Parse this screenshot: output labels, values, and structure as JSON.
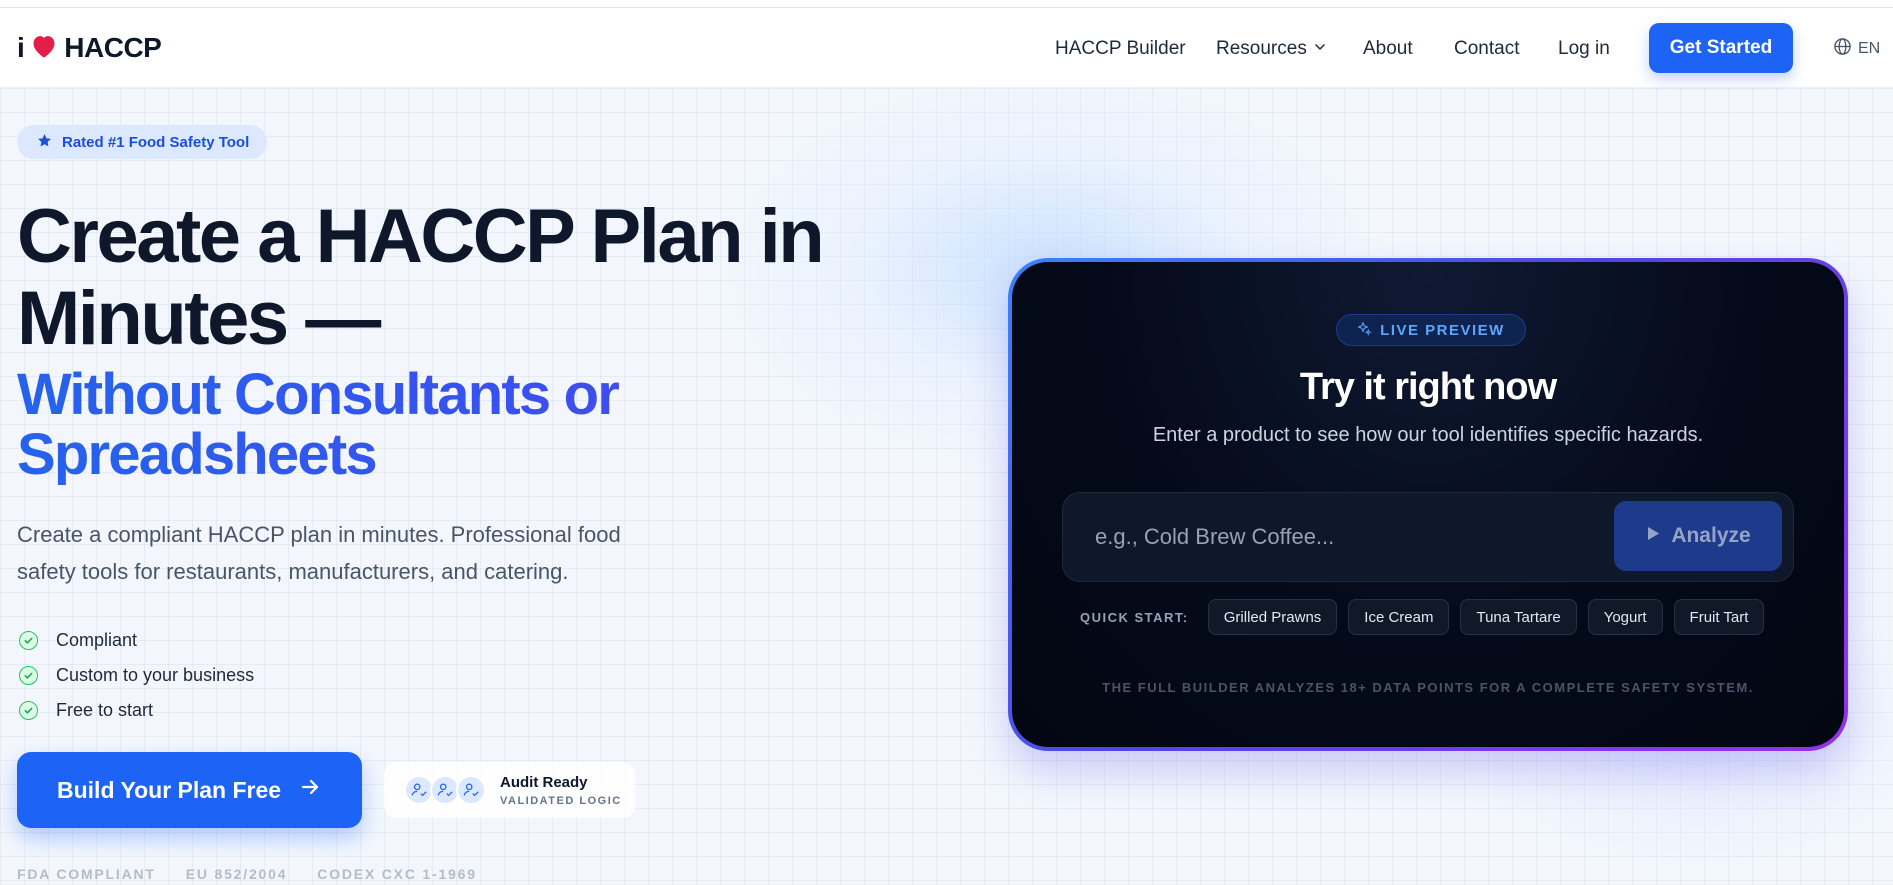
{
  "nav": {
    "logo_i": "i",
    "logo_text": "HACCP",
    "links": {
      "builder": "HACCP Builder",
      "resources": "Resources",
      "about": "About",
      "contact": "Contact",
      "login": "Log in"
    },
    "cta": "Get Started",
    "language": "EN"
  },
  "hero": {
    "badge": "Rated #1 Food Safety Tool",
    "title_line1": "Create a HACCP Plan in",
    "title_line2": "Minutes —",
    "accent_line1": "Without Consultants or",
    "accent_line2": "Spreadsheets",
    "subtitle": "Create a compliant HACCP plan in minutes. Professional food safety tools for restaurants, manufacturers, and catering.",
    "checks": [
      "Compliant",
      "Custom to your business",
      "Free to start"
    ],
    "cta": "Build Your Plan Free",
    "audit_title": "Audit Ready",
    "audit_sub": "VALIDATED LOGIC",
    "compliance": [
      "FDA COMPLIANT",
      "EU 852/2004",
      "CODEX CXC 1-1969"
    ]
  },
  "preview": {
    "badge": "LIVE PREVIEW",
    "title": "Try it right now",
    "subtitle": "Enter a product to see how our tool identifies specific hazards.",
    "input_placeholder": "e.g., Cold Brew Coffee...",
    "input_value": "",
    "analyze": "Analyze",
    "quick_label": "QUICK START:",
    "quick_items": [
      "Grilled Prawns",
      "Ice Cream",
      "Tuna Tartare",
      "Yogurt",
      "Fruit Tart"
    ],
    "footer": "THE FULL BUILDER ANALYZES 18+ DATA POINTS FOR A COMPLETE SAFETY SYSTEM."
  },
  "colors": {
    "primary": "#1d63f5",
    "accent_start": "#2563eb",
    "accent_end": "#4f46e5",
    "heart": "#e11d48",
    "check": "#22c55e",
    "card_bg": "#050a1a"
  },
  "icons": [
    "heart-icon",
    "chevron-down-icon",
    "globe-icon",
    "star-icon",
    "check-circle-icon",
    "arrow-right-icon",
    "user-check-icon",
    "sparkle-icon",
    "play-icon"
  ]
}
